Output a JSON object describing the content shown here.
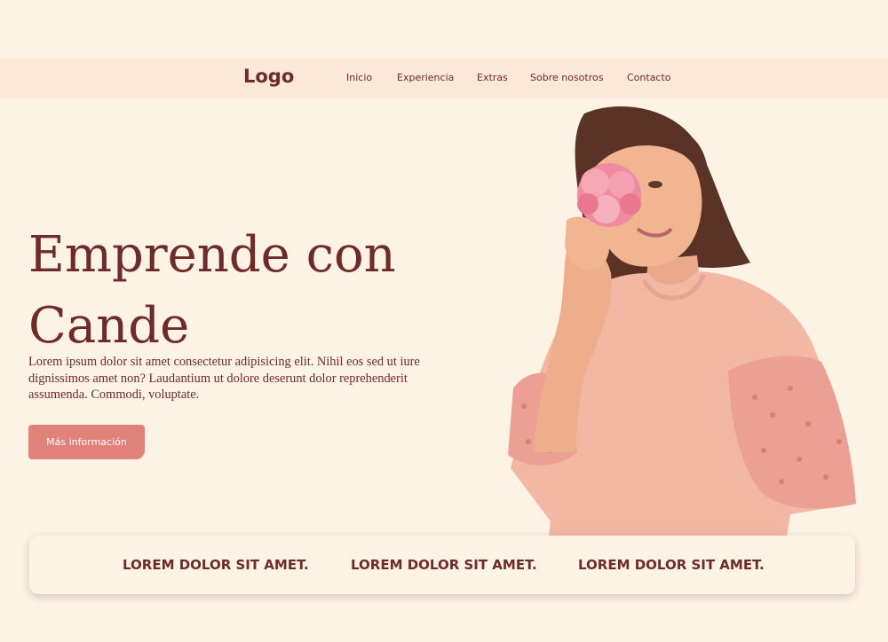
{
  "header": {
    "logo": "Logo",
    "nav": [
      "Inicio",
      "Experiencia",
      "Extras",
      "Sobre nosotros",
      "Contacto"
    ]
  },
  "hero": {
    "title_line1": "Emprende con",
    "title_line2": "Cande",
    "text": "Lorem ipsum dolor sit amet consectetur adipisicing elit. Nihil eos sed ut iure dignissimos amet non? Laudantium ut dolore deserunt dolor reprehenderit assumenda. Commodi, voluptate.",
    "button_label": "Más información"
  },
  "features": [
    "LOREM DOLOR SIT AMET.",
    "LOREM DOLOR SIT AMET.",
    "LOREM DOLOR SIT AMET."
  ],
  "colors": {
    "background": "#fdf3e4",
    "navbar": "#fbe8d6",
    "text": "#6e2b27",
    "accent": "#e08279",
    "shirt": "#f2b8a4",
    "hair": "#5a3326",
    "skin": "#f1b592",
    "flower": "#ef8aa0"
  }
}
